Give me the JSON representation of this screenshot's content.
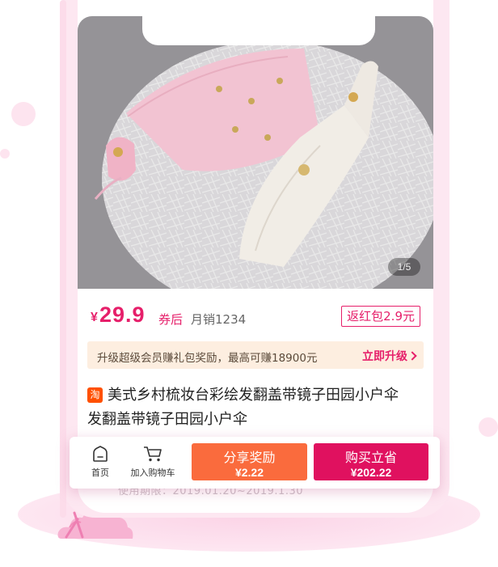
{
  "product": {
    "image_page_indicator": "1/5",
    "price_symbol": "¥",
    "price": "29.9",
    "after_coupon_label": "券后",
    "monthly_sales": "月销1234",
    "red_packet": "返红包2.9元",
    "platform_badge": "淘",
    "title_line1": "美式乡村梳妆台彩绘发翻盖带镜子田园小户伞",
    "title_line2": "发翻盖带镜子田园小户伞",
    "faded_text": "使用期限：2019.01.20~2019.1.30"
  },
  "upgrade_banner": {
    "text": "升级超级会员赚礼包奖励，最高可赚18900元",
    "link": "立即升级"
  },
  "action_bar": {
    "home_label": "首页",
    "cart_label": "加入购物车",
    "share_label": "分享奖励",
    "share_amount": "¥2.22",
    "buy_label": "购买立省",
    "buy_amount": "¥202.22"
  },
  "colors": {
    "accent": "#e61f6a",
    "share_button": "#fa6b3d",
    "buy_button": "#e0115f",
    "banner_bg": "#fdeee0",
    "phone_frame": "#fde7f1"
  },
  "icons": {
    "home": "home-icon",
    "cart": "cart-icon",
    "link_arrow": "chevron-right-icon"
  }
}
